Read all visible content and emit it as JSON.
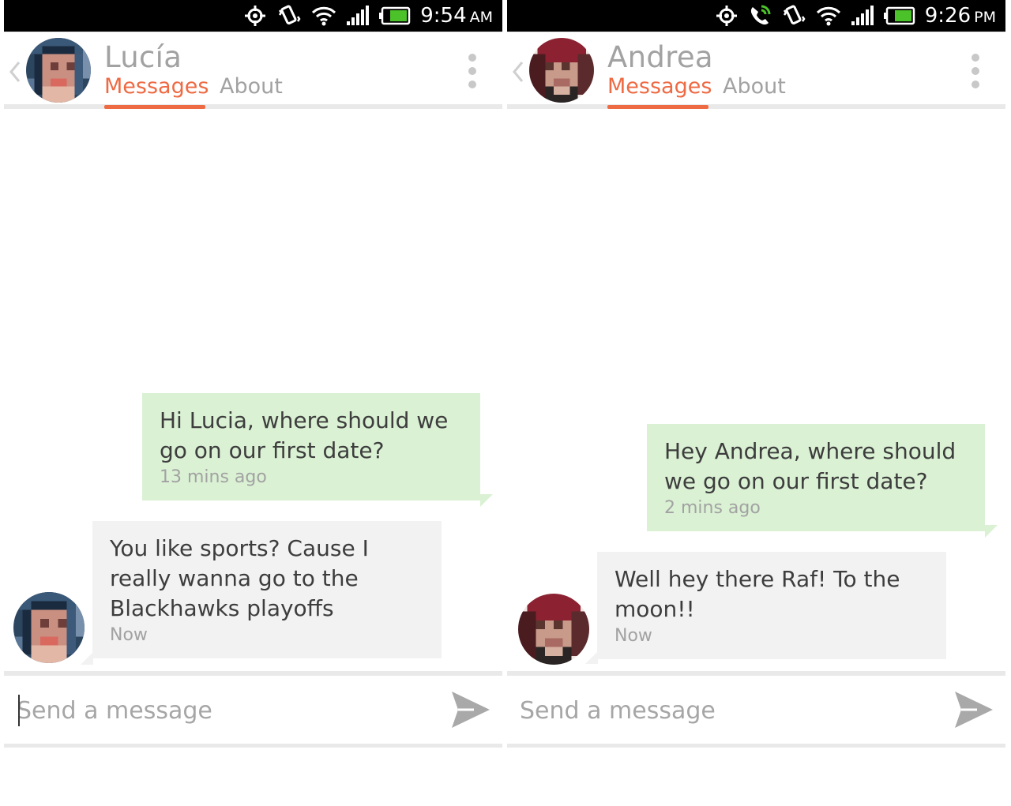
{
  "screens": [
    {
      "statusbar": {
        "time": "9:54",
        "ampm": "AM"
      },
      "header": {
        "contact_name": "Lucía",
        "tabs": {
          "messages": "Messages",
          "about": "About"
        },
        "active_tab": "Messages"
      },
      "messages": [
        {
          "direction": "outgoing",
          "text": "Hi Lucia, where should we go on our first date?",
          "time": "13 mins ago"
        },
        {
          "direction": "incoming",
          "text": "You like sports? Cause I really wanna go to the Blackhawks playoffs",
          "time": "Now"
        }
      ],
      "composer": {
        "placeholder": "Send a message",
        "value": ""
      }
    },
    {
      "statusbar": {
        "time": "9:26",
        "ampm": "PM"
      },
      "header": {
        "contact_name": "Andrea",
        "tabs": {
          "messages": "Messages",
          "about": "About"
        },
        "active_tab": "Messages"
      },
      "messages": [
        {
          "direction": "outgoing",
          "text": "Hey Andrea, where should we go on our first date?",
          "time": "2 mins ago"
        },
        {
          "direction": "incoming",
          "text": "Well hey there Raf! To the moon!!",
          "time": "Now"
        }
      ],
      "composer": {
        "placeholder": "Send a message",
        "value": ""
      }
    }
  ],
  "colors": {
    "accent": "#ee6a43",
    "outgoing_bubble": "#daf1d4",
    "incoming_bubble": "#f2f2f2",
    "muted_text": "#a2a2a2",
    "message_text": "#3d3d3d",
    "status_bar": "#000000"
  },
  "icons": {
    "statusbar_left": [
      "gps-icon",
      "vibrate-icon",
      "wifi-icon",
      "signal-icon",
      "battery-icon"
    ],
    "statusbar_right": [
      "gps-icon",
      "call-forward-icon",
      "vibrate-icon",
      "wifi-icon",
      "signal-icon",
      "battery-icon"
    ],
    "header": [
      "back-chevron-icon",
      "avatar",
      "overflow-menu-icon"
    ],
    "composer": [
      "send-icon"
    ]
  }
}
